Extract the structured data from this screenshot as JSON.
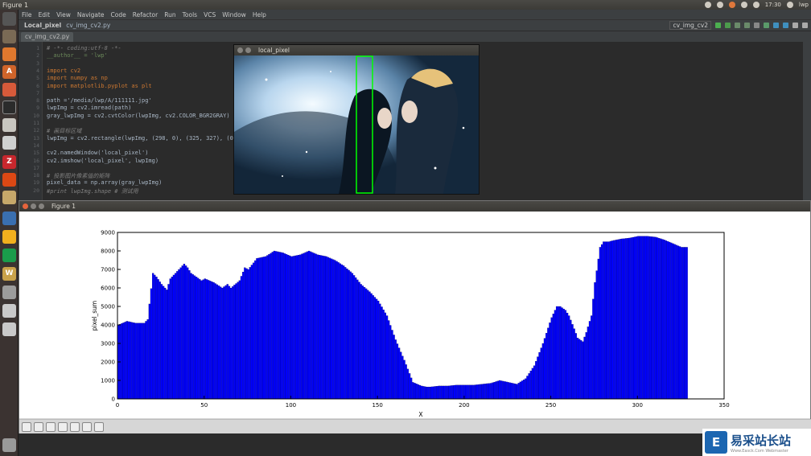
{
  "topbar": {
    "title": "Figure 1",
    "clock": "17:30",
    "user": "lwp"
  },
  "menu": [
    "File",
    "Edit",
    "View",
    "Navigate",
    "Code",
    "Refactor",
    "Run",
    "Tools",
    "VCS",
    "Window",
    "Help"
  ],
  "nav": {
    "project": "Local_pixel",
    "file": "cv_img_cv2.py",
    "run_config": "cv_img_cv2"
  },
  "tab": {
    "label": "cv_img_cv2.py"
  },
  "code_lines": [
    {
      "n": "1",
      "t": "# -*- coding:utf-8 -*-",
      "c": "cm"
    },
    {
      "n": "2",
      "t": "__author__ = 'lwp'",
      "c": "str"
    },
    {
      "n": "3",
      "t": "",
      "c": ""
    },
    {
      "n": "4",
      "t": "import cv2",
      "c": "kw"
    },
    {
      "n": "5",
      "t": "import numpy as np",
      "c": "kw"
    },
    {
      "n": "6",
      "t": "import matplotlib.pyplot as plt",
      "c": "kw"
    },
    {
      "n": "7",
      "t": "",
      "c": ""
    },
    {
      "n": "8",
      "t": "path ='/media/lwp/A/111111.jpg'",
      "c": ""
    },
    {
      "n": "9",
      "t": "lwpImg = cv2.imread(path)",
      "c": ""
    },
    {
      "n": "10",
      "t": "gray_lwpImg = cv2.cvtColor(lwpImg, cv2.COLOR_BGR2GRAY)",
      "c": ""
    },
    {
      "n": "11",
      "t": "",
      "c": ""
    },
    {
      "n": "12",
      "t": "# 画目标区域",
      "c": "cm"
    },
    {
      "n": "13",
      "t": "lwpImg = cv2.rectangle(lwpImg, (298, 0), (325, 327), (0",
      "c": ""
    },
    {
      "n": "14",
      "t": "",
      "c": ""
    },
    {
      "n": "15",
      "t": "cv2.namedWindow('local_pixel')",
      "c": ""
    },
    {
      "n": "16",
      "t": "cv2.imshow('local_pixel', lwpImg)",
      "c": ""
    },
    {
      "n": "17",
      "t": "",
      "c": ""
    },
    {
      "n": "18",
      "t": "# 投影图片像素值的矩阵",
      "c": "cm"
    },
    {
      "n": "19",
      "t": "pixel_data = np.array(gray_lwpImg)",
      "c": ""
    },
    {
      "n": "20",
      "t": "#print lwpImg.shape # 测试用",
      "c": "cm"
    }
  ],
  "image_window": {
    "title": "local_pixel"
  },
  "figure_window": {
    "title": "Figure 1"
  },
  "chart_data": {
    "type": "bar",
    "xlabel": "X",
    "ylabel": "pixel_sum",
    "xlim": [
      0,
      350
    ],
    "ylim": [
      0,
      9000
    ],
    "xticks": [
      0,
      50,
      100,
      150,
      200,
      250,
      300,
      350
    ],
    "yticks": [
      0,
      1000,
      2000,
      3000,
      4000,
      5000,
      6000,
      7000,
      8000,
      9000
    ],
    "x": [
      0,
      5,
      10,
      15,
      17,
      20,
      22,
      25,
      28,
      30,
      33,
      36,
      38,
      40,
      42,
      45,
      48,
      50,
      55,
      60,
      63,
      65,
      70,
      73,
      75,
      80,
      85,
      90,
      95,
      100,
      105,
      110,
      115,
      120,
      125,
      130,
      135,
      140,
      145,
      150,
      155,
      160,
      165,
      170,
      175,
      178,
      180,
      185,
      190,
      195,
      200,
      205,
      210,
      215,
      220,
      225,
      230,
      235,
      240,
      245,
      250,
      253,
      255,
      258,
      260,
      263,
      265,
      268,
      270,
      273,
      275,
      278,
      280,
      283,
      285,
      290,
      295,
      300,
      305,
      310,
      315,
      320,
      325,
      328
    ],
    "values": [
      4000,
      4200,
      4100,
      4100,
      4300,
      6800,
      6600,
      6200,
      5900,
      6500,
      6800,
      7100,
      7300,
      7100,
      6800,
      6600,
      6400,
      6500,
      6300,
      6000,
      6200,
      6000,
      6400,
      7100,
      7000,
      7600,
      7700,
      8000,
      7900,
      7700,
      7800,
      8000,
      7800,
      7700,
      7500,
      7200,
      6800,
      6200,
      5800,
      5300,
      4500,
      3200,
      2100,
      900,
      700,
      650,
      650,
      700,
      700,
      750,
      750,
      750,
      800,
      850,
      1000,
      900,
      800,
      1100,
      1800,
      3000,
      4400,
      5000,
      5000,
      4800,
      4500,
      3800,
      3300,
      3100,
      3600,
      4500,
      6300,
      8200,
      8500,
      8500,
      8550,
      8650,
      8700,
      8800,
      8800,
      8750,
      8600,
      8400,
      8200,
      8200
    ]
  },
  "watermark": {
    "brand": "易采站长站",
    "sub": "Www.Easck.Com Webmaster"
  }
}
